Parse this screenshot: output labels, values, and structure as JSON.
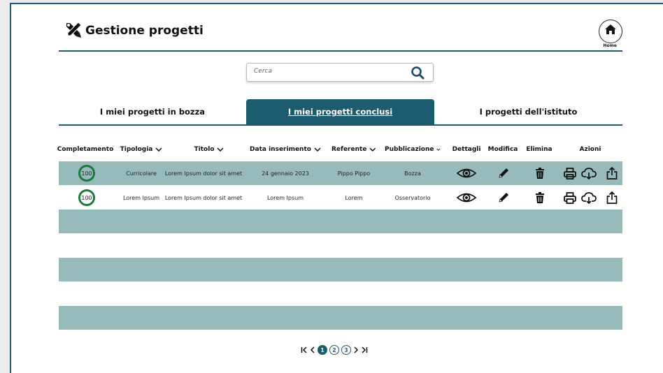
{
  "header": {
    "title": "Gestione progetti",
    "home_label": "Home"
  },
  "search": {
    "placeholder": "Cerca"
  },
  "tabs": [
    {
      "label": "I miei progetti in bozza"
    },
    {
      "label": "I miei progetti conclusi"
    },
    {
      "label": "I progetti dell'istituto"
    }
  ],
  "table": {
    "headers": {
      "completamento": "Completamento",
      "tipologia": "Tipologia",
      "titolo": "Titolo",
      "data": "Data inserimento",
      "referente": "Referente",
      "pubblicazione": "Pubblicazione",
      "dettagli": "Dettagli",
      "modifica": "Modifica",
      "elimina": "Elimina",
      "azioni": "Azioni"
    },
    "rows": [
      {
        "completamento": "100",
        "tipologia": "Curricolare",
        "titolo": "Lorem Ipsum dolor sit amet",
        "data": "24 gennaio 2023",
        "referente": "Pippo Pippo",
        "pubblicazione": "Bozza"
      },
      {
        "completamento": "100",
        "tipologia": "Lorem Ipsum",
        "titolo": "Lorem Ipsum dolor sit amet",
        "data": "Lorem Ipsum",
        "referente": "Lorem",
        "pubblicazione": "Osservatorio"
      }
    ]
  },
  "pagination": {
    "pages": [
      "1",
      "2",
      "3"
    ],
    "current": "1"
  },
  "colors": {
    "accent": "#1d5c6e",
    "row_shade": "#97baba",
    "ring": "#1c7a3c"
  }
}
